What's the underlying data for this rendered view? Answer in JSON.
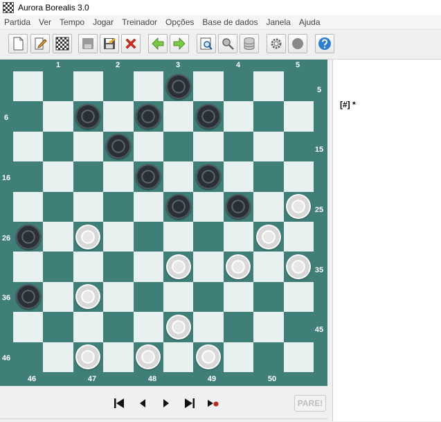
{
  "window": {
    "title": "Aurora Borealis 3.0"
  },
  "menu": [
    "Partida",
    "Ver",
    "Tempo",
    "Jogar",
    "Treinador",
    "Opções",
    "Base de dados",
    "Janela",
    "Ajuda"
  ],
  "toolbar": {
    "buttons": [
      "new-document-icon",
      "edit-icon",
      "board-icon",
      "save-disabled-icon",
      "save-icon",
      "delete-icon",
      "arrow-left-icon",
      "arrow-right-icon",
      "zoom-board-icon",
      "search-icon",
      "database-icon",
      "settings-gear-icon",
      "engine-icon",
      "help-icon"
    ]
  },
  "board": {
    "top_labels": [
      "1",
      "2",
      "3",
      "4",
      "5"
    ],
    "bottom_labels": [
      "46",
      "47",
      "48",
      "49",
      "50"
    ],
    "left_labels": [
      "6",
      "16",
      "26",
      "36",
      "46"
    ],
    "right_labels": [
      "5",
      "15",
      "25",
      "35",
      "45"
    ],
    "colors": {
      "light": "#e6f1f0",
      "dark": "#3f7f78"
    },
    "pieces": {
      "black": [
        3,
        7,
        8,
        9,
        12,
        18,
        19,
        23,
        24,
        26,
        36
      ],
      "white": [
        25,
        27,
        30,
        33,
        34,
        35,
        37,
        43,
        47,
        48,
        49
      ]
    }
  },
  "notation": {
    "text": "[#]  *"
  },
  "controls": {
    "stop_label": "PARE!"
  }
}
